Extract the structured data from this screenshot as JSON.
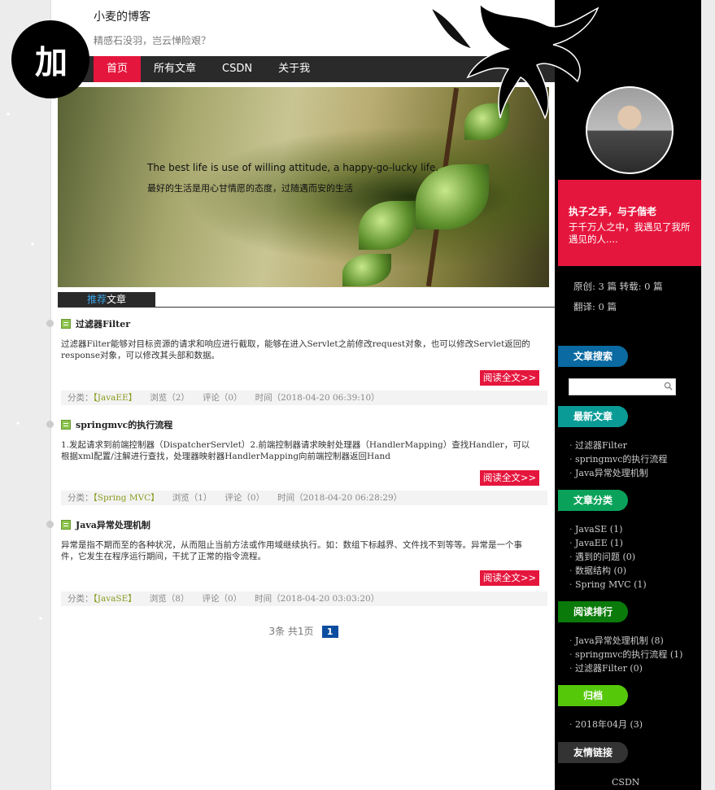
{
  "site": {
    "title": "小麦的博客",
    "subtitle": "精感石没羽，岂云惮险艰？",
    "badge": "加"
  },
  "nav": {
    "items": [
      {
        "label": "首页",
        "active": true
      },
      {
        "label": "所有文章",
        "active": false
      },
      {
        "label": "CSDN",
        "active": false
      },
      {
        "label": "关于我",
        "active": false
      }
    ]
  },
  "banner": {
    "en": "The best life is use of willing attitude, a happy-go-lucky life.",
    "cn": "最好的生活是用心甘情愿的态度，过随遇而安的生活"
  },
  "section": {
    "highlight": "推荐",
    "label": "文章"
  },
  "articles": [
    {
      "title": "过滤器Filter",
      "body": "过滤器Filter能够对目标资源的请求和响应进行截取，能够在进入Servlet之前修改request对象，也可以修改Servlet返回的response对象，可以修改其头部和数据。",
      "read_more": "阅读全文>>",
      "category_label": "分类：",
      "category": "【JavaEE】",
      "views": "浏览（2）",
      "comments": "评论（0）",
      "time": "时间（2018-04-20 06:39:10）"
    },
    {
      "title": "springmvc的执行流程",
      "body": "1.发起请求到前端控制器（DispatcherServlet）2.前端控制器请求映射处理器（HandlerMapping）查找Handler，可以根据xml配置/注解进行查找，处理器映射器HandlerMapping向前端控制器返回Hand",
      "read_more": "阅读全文>>",
      "category_label": "分类：",
      "category": "【Spring MVC】",
      "views": "浏览（1）",
      "comments": "评论（0）",
      "time": "时间（2018-04-20 06:28:29）"
    },
    {
      "title": "Java异常处理机制",
      "body": "异常是指不期而至的各种状况，从而阻止当前方法或作用域继续执行。如：数组下标越界、文件找不到等等。异常是一个事件，它发生在程序运行期间，干扰了正常的指令流程。",
      "read_more": "阅读全文>>",
      "category_label": "分类：",
      "category": "【JavaSE】",
      "views": "浏览（8）",
      "comments": "评论（0）",
      "time": "时间（2018-04-20 03:03:20）"
    }
  ],
  "pager": {
    "summary": "3条 共1页",
    "page": "1"
  },
  "sidebar": {
    "quote_title": "执子之手，与子偕老",
    "quote_text": "于千万人之中，我遇见了我所遇见的人....",
    "stats_line1": "原创: 3 篇  转载: 0 篇",
    "stats_line2": "翻译: 0 篇",
    "search_tab": "文章搜索",
    "search_value": "",
    "recent_tab": "最新文章",
    "recent": [
      "过滤器Filter",
      "springmvc的执行流程",
      "Java异常处理机制"
    ],
    "category_tab": "文章分类",
    "categories": [
      "JavaSE (1)",
      "JavaEE (1)",
      "遇到的问题 (0)",
      "数据结构 (0)",
      "Spring MVC (1)"
    ],
    "rank_tab": "阅读排行",
    "rank": [
      "Java异常处理机制 (8)",
      "springmvc的执行流程 (1)",
      "过滤器Filter (0)"
    ],
    "archive_tab": "归档",
    "archive": [
      "2018年04月 (3)"
    ],
    "links_tab": "友情链接",
    "links": [
      "CSDN"
    ],
    "tab_colors": {
      "search": "#0a6aa1",
      "recent": "#0a9b96",
      "category": "#0aa25a",
      "rank": "#0a7a0a",
      "archive": "#55c80a",
      "links": "#333333"
    }
  }
}
